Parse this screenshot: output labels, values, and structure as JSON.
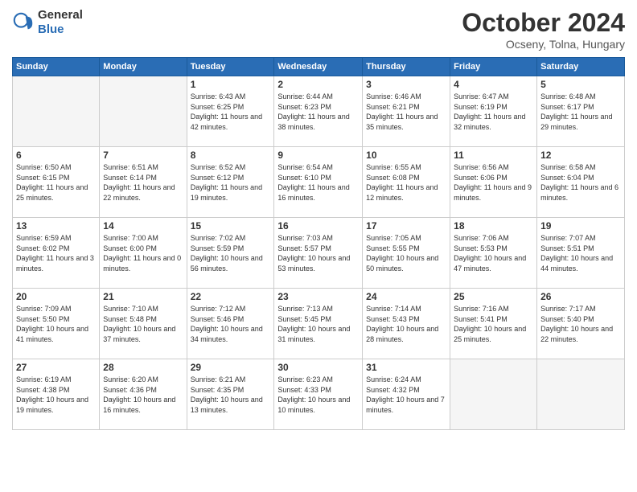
{
  "header": {
    "logo_general": "General",
    "logo_blue": "Blue",
    "month_title": "October 2024",
    "location": "Ocseny, Tolna, Hungary"
  },
  "days_of_week": [
    "Sunday",
    "Monday",
    "Tuesday",
    "Wednesday",
    "Thursday",
    "Friday",
    "Saturday"
  ],
  "weeks": [
    [
      {
        "day": "",
        "empty": true
      },
      {
        "day": "",
        "empty": true
      },
      {
        "day": "1",
        "sunrise": "6:43 AM",
        "sunset": "6:25 PM",
        "daylight": "11 hours and 42 minutes."
      },
      {
        "day": "2",
        "sunrise": "6:44 AM",
        "sunset": "6:23 PM",
        "daylight": "11 hours and 38 minutes."
      },
      {
        "day": "3",
        "sunrise": "6:46 AM",
        "sunset": "6:21 PM",
        "daylight": "11 hours and 35 minutes."
      },
      {
        "day": "4",
        "sunrise": "6:47 AM",
        "sunset": "6:19 PM",
        "daylight": "11 hours and 32 minutes."
      },
      {
        "day": "5",
        "sunrise": "6:48 AM",
        "sunset": "6:17 PM",
        "daylight": "11 hours and 29 minutes."
      }
    ],
    [
      {
        "day": "6",
        "sunrise": "6:50 AM",
        "sunset": "6:15 PM",
        "daylight": "11 hours and 25 minutes."
      },
      {
        "day": "7",
        "sunrise": "6:51 AM",
        "sunset": "6:14 PM",
        "daylight": "11 hours and 22 minutes."
      },
      {
        "day": "8",
        "sunrise": "6:52 AM",
        "sunset": "6:12 PM",
        "daylight": "11 hours and 19 minutes."
      },
      {
        "day": "9",
        "sunrise": "6:54 AM",
        "sunset": "6:10 PM",
        "daylight": "11 hours and 16 minutes."
      },
      {
        "day": "10",
        "sunrise": "6:55 AM",
        "sunset": "6:08 PM",
        "daylight": "11 hours and 12 minutes."
      },
      {
        "day": "11",
        "sunrise": "6:56 AM",
        "sunset": "6:06 PM",
        "daylight": "11 hours and 9 minutes."
      },
      {
        "day": "12",
        "sunrise": "6:58 AM",
        "sunset": "6:04 PM",
        "daylight": "11 hours and 6 minutes."
      }
    ],
    [
      {
        "day": "13",
        "sunrise": "6:59 AM",
        "sunset": "6:02 PM",
        "daylight": "11 hours and 3 minutes."
      },
      {
        "day": "14",
        "sunrise": "7:00 AM",
        "sunset": "6:00 PM",
        "daylight": "11 hours and 0 minutes."
      },
      {
        "day": "15",
        "sunrise": "7:02 AM",
        "sunset": "5:59 PM",
        "daylight": "10 hours and 56 minutes."
      },
      {
        "day": "16",
        "sunrise": "7:03 AM",
        "sunset": "5:57 PM",
        "daylight": "10 hours and 53 minutes."
      },
      {
        "day": "17",
        "sunrise": "7:05 AM",
        "sunset": "5:55 PM",
        "daylight": "10 hours and 50 minutes."
      },
      {
        "day": "18",
        "sunrise": "7:06 AM",
        "sunset": "5:53 PM",
        "daylight": "10 hours and 47 minutes."
      },
      {
        "day": "19",
        "sunrise": "7:07 AM",
        "sunset": "5:51 PM",
        "daylight": "10 hours and 44 minutes."
      }
    ],
    [
      {
        "day": "20",
        "sunrise": "7:09 AM",
        "sunset": "5:50 PM",
        "daylight": "10 hours and 41 minutes."
      },
      {
        "day": "21",
        "sunrise": "7:10 AM",
        "sunset": "5:48 PM",
        "daylight": "10 hours and 37 minutes."
      },
      {
        "day": "22",
        "sunrise": "7:12 AM",
        "sunset": "5:46 PM",
        "daylight": "10 hours and 34 minutes."
      },
      {
        "day": "23",
        "sunrise": "7:13 AM",
        "sunset": "5:45 PM",
        "daylight": "10 hours and 31 minutes."
      },
      {
        "day": "24",
        "sunrise": "7:14 AM",
        "sunset": "5:43 PM",
        "daylight": "10 hours and 28 minutes."
      },
      {
        "day": "25",
        "sunrise": "7:16 AM",
        "sunset": "5:41 PM",
        "daylight": "10 hours and 25 minutes."
      },
      {
        "day": "26",
        "sunrise": "7:17 AM",
        "sunset": "5:40 PM",
        "daylight": "10 hours and 22 minutes."
      }
    ],
    [
      {
        "day": "27",
        "sunrise": "6:19 AM",
        "sunset": "4:38 PM",
        "daylight": "10 hours and 19 minutes."
      },
      {
        "day": "28",
        "sunrise": "6:20 AM",
        "sunset": "4:36 PM",
        "daylight": "10 hours and 16 minutes."
      },
      {
        "day": "29",
        "sunrise": "6:21 AM",
        "sunset": "4:35 PM",
        "daylight": "10 hours and 13 minutes."
      },
      {
        "day": "30",
        "sunrise": "6:23 AM",
        "sunset": "4:33 PM",
        "daylight": "10 hours and 10 minutes."
      },
      {
        "day": "31",
        "sunrise": "6:24 AM",
        "sunset": "4:32 PM",
        "daylight": "10 hours and 7 minutes."
      },
      {
        "day": "",
        "empty": true
      },
      {
        "day": "",
        "empty": true
      }
    ]
  ]
}
